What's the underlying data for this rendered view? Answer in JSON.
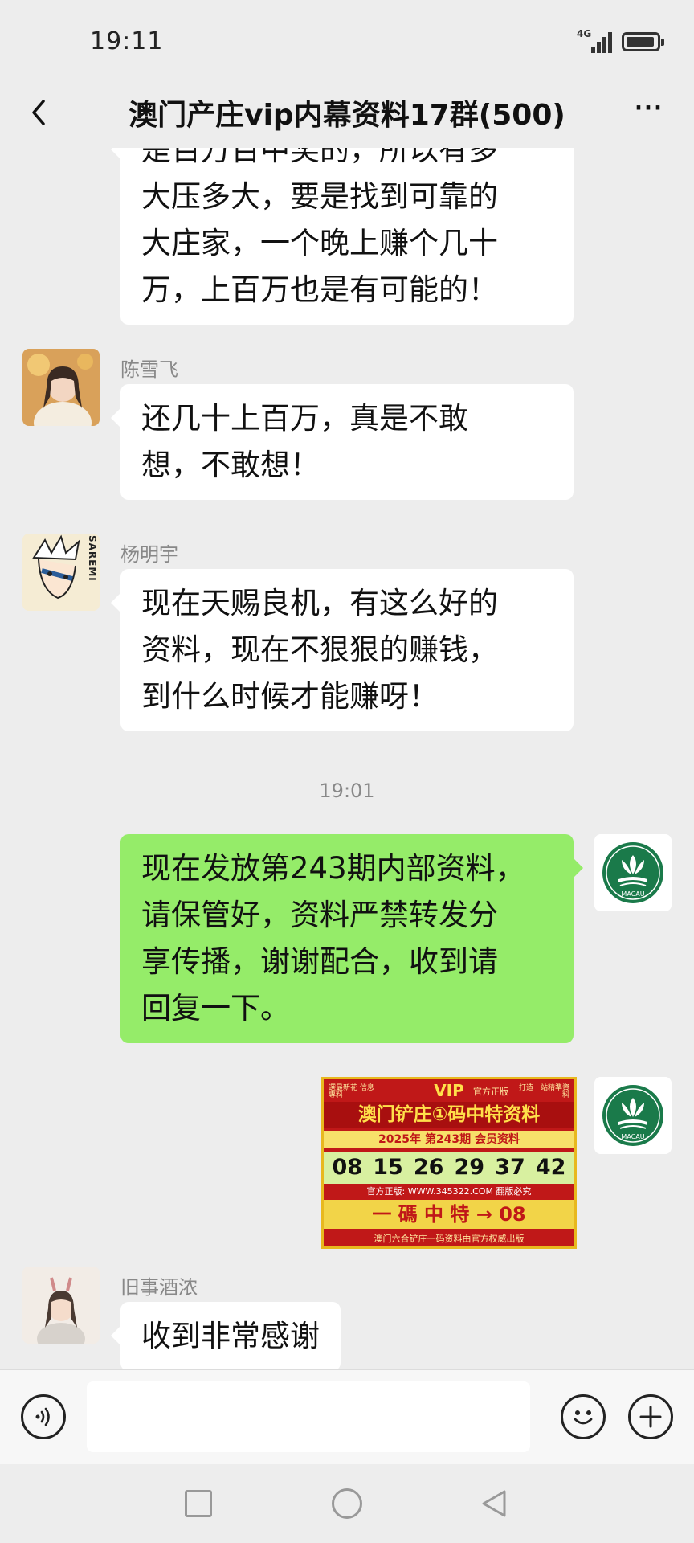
{
  "status_bar": {
    "time": "19:11",
    "network": "4G"
  },
  "header": {
    "title": "澳门产庄vip内幕资料17群(500)",
    "more": "···"
  },
  "messages": {
    "m1_text": "是百万百中奖的，所以有多\n大压多大，要是找到可靠的\n大庄家，一个晚上赚个几十\n万，上百万也是有可能的！",
    "m2_sender": "陈雪飞",
    "m2_text": "还几十上百万，真是不敢\n想，不敢想！",
    "m3_sender": "杨明宇",
    "m3_avatar_text": "SAREMI",
    "m3_text": "现在天赐良机，有这么好的\n资料，现在不狠狠的赚钱，\n到什么时候才能赚呀！",
    "timestamp": "19:01",
    "m4_text": "现在发放第243期内部资料，\n请保管好，资料严禁转发分\n享传播，谢谢配合，收到请\n回复一下。",
    "macau_emblem_text": "MACAU",
    "m6_sender": "旧事酒浓",
    "m6_text": "收到非常感谢"
  },
  "vip_card": {
    "vip_label": "VIP",
    "left_small": "選最新花 信息專料",
    "right_small": "打造一站精準資料",
    "official": "官方正版",
    "title": "澳门铲庄①码中特资料",
    "year_line": "2025年 第243期 会员资料",
    "numbers": [
      "08",
      "15",
      "26",
      "29",
      "37",
      "42"
    ],
    "url": "官方正版: WWW.345322.COM 翻版必究",
    "special": "一 碼 中 特 → 08",
    "footer": "澳门六合铲庄一码资料由官方权威出版"
  },
  "colors": {
    "background": "#ededed",
    "bubble_left": "#ffffff",
    "bubble_right": "#95ec69",
    "vip_red": "#c01818",
    "vip_gold": "#ffe04a",
    "emblem_green": "#1a7a4a"
  },
  "icons": {
    "back": "chevron-left-icon",
    "more": "more-dots-icon",
    "voice": "voice-icon",
    "emoji": "emoji-icon",
    "plus": "plus-icon"
  }
}
